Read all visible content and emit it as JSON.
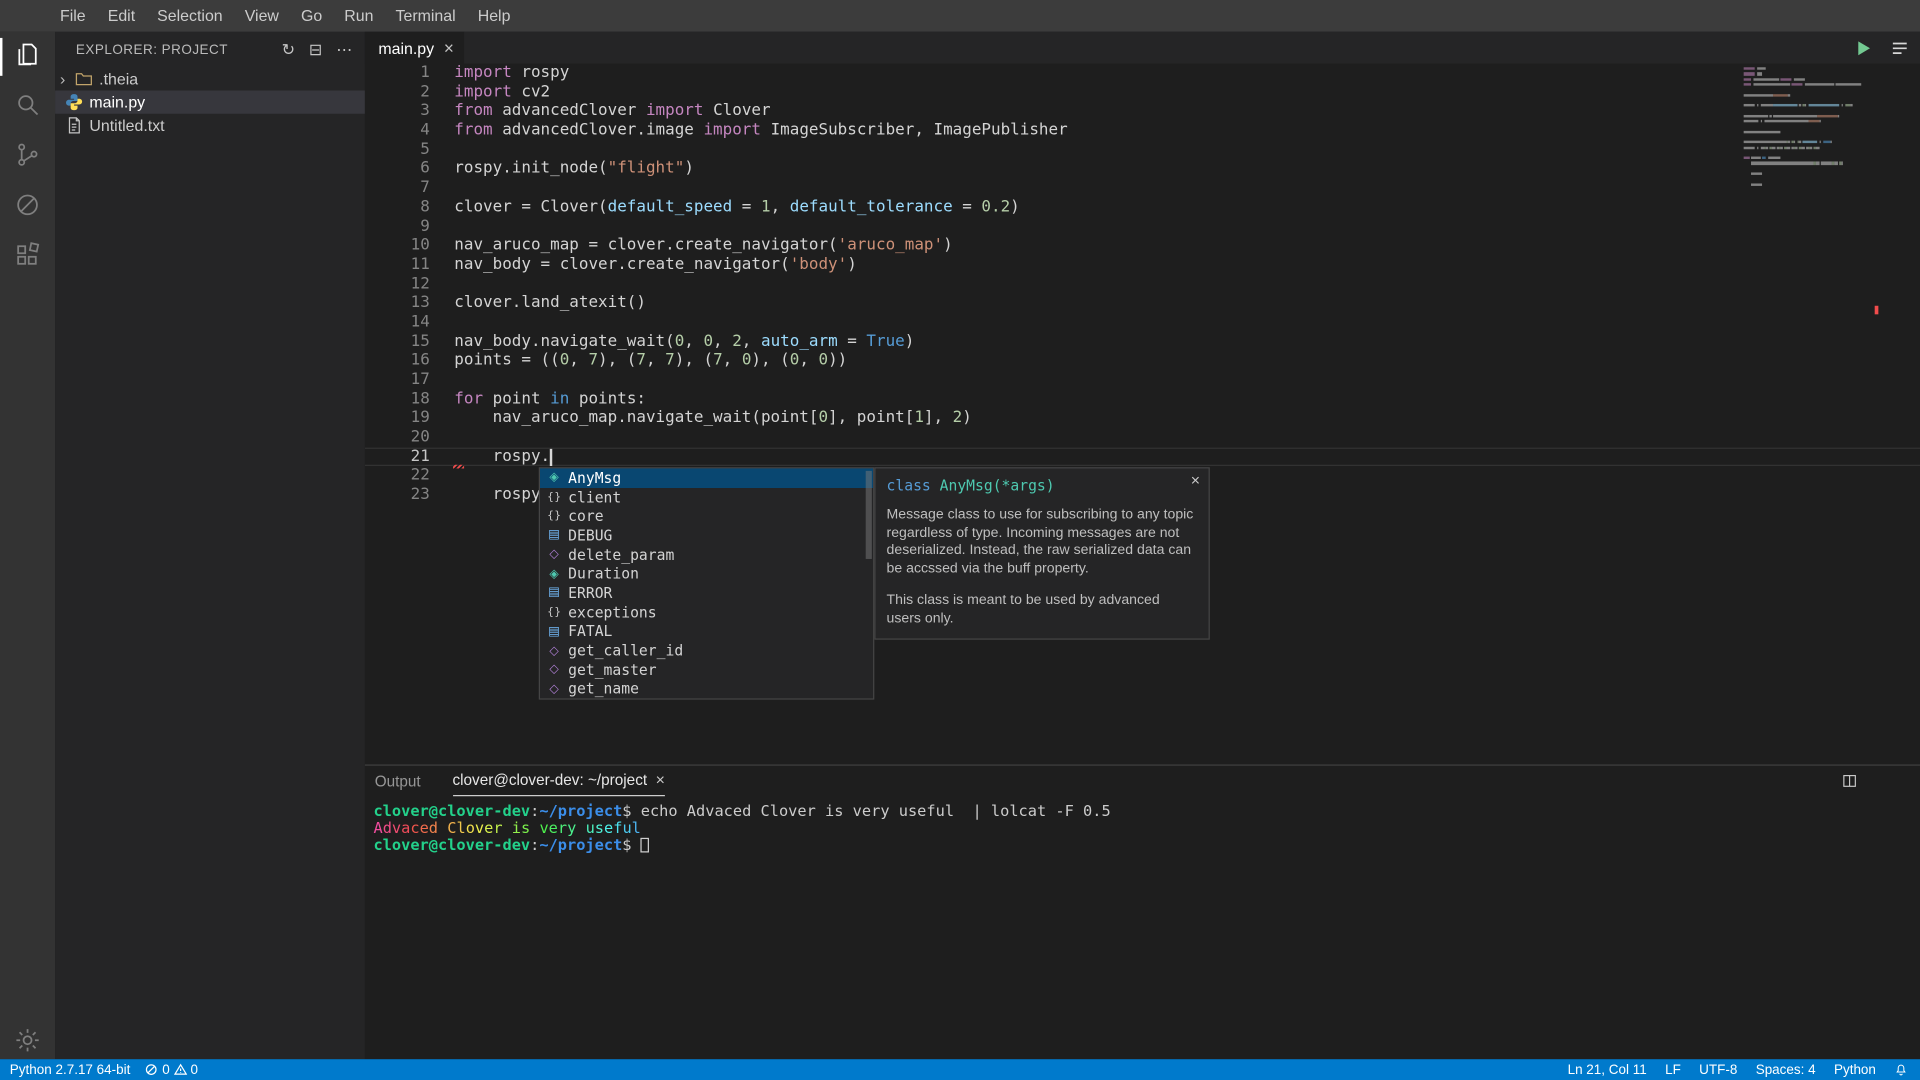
{
  "colors": {
    "accent": "#007acc",
    "selection": "#094771",
    "error": "#f14c4c"
  },
  "menu_bar": {
    "items": [
      "File",
      "Edit",
      "Selection",
      "View",
      "Go",
      "Run",
      "Terminal",
      "Help"
    ]
  },
  "activity_bar": {
    "items": [
      {
        "id": "explorer",
        "icon": "files-icon",
        "active": true
      },
      {
        "id": "search",
        "icon": "search-icon",
        "active": false
      },
      {
        "id": "source-control",
        "icon": "source-control-icon",
        "active": false
      },
      {
        "id": "debug",
        "icon": "debug-icon",
        "active": false
      },
      {
        "id": "extensions",
        "icon": "extensions-icon",
        "active": false
      }
    ],
    "bottom_items": [
      {
        "id": "settings",
        "icon": "gear-icon"
      }
    ]
  },
  "explorer": {
    "title": "EXPLORER: PROJECT",
    "toolbar": [
      {
        "id": "refresh",
        "icon": "refresh-icon"
      },
      {
        "id": "collapse-all",
        "icon": "collapse-all-icon"
      },
      {
        "id": "more-actions",
        "icon": "ellipsis-icon"
      }
    ],
    "tree": [
      {
        "label": ".theia",
        "kind": "folder",
        "collapsed": true,
        "selected": false
      },
      {
        "label": "main.py",
        "kind": "python-file",
        "selected": true
      },
      {
        "label": "Untitled.txt",
        "kind": "text-file",
        "selected": false
      }
    ]
  },
  "editor": {
    "tabs": [
      {
        "label": "main.py",
        "active": true
      }
    ],
    "actions": [
      {
        "id": "run",
        "icon": "run-icon"
      },
      {
        "id": "open-editors",
        "icon": "layout-icon"
      }
    ],
    "cursor": {
      "line": 21,
      "col": 11
    },
    "lines": [
      {
        "n": 1,
        "t": [
          [
            "k",
            "import"
          ],
          [
            "p",
            " rospy"
          ]
        ]
      },
      {
        "n": 2,
        "t": [
          [
            "k",
            "import"
          ],
          [
            "p",
            " cv2"
          ]
        ]
      },
      {
        "n": 3,
        "t": [
          [
            "k",
            "from"
          ],
          [
            "p",
            " advancedClover "
          ],
          [
            "k",
            "import"
          ],
          [
            "p",
            " Clover"
          ]
        ]
      },
      {
        "n": 4,
        "t": [
          [
            "k",
            "from"
          ],
          [
            "p",
            " advancedClover.image "
          ],
          [
            "k",
            "import"
          ],
          [
            "p",
            " ImageSubscriber, ImagePublisher"
          ]
        ]
      },
      {
        "n": 5,
        "t": []
      },
      {
        "n": 6,
        "t": [
          [
            "p",
            "rospy.init_node("
          ],
          [
            "s",
            "\"flight\""
          ],
          [
            "p",
            ")"
          ]
        ]
      },
      {
        "n": 7,
        "t": []
      },
      {
        "n": 8,
        "t": [
          [
            "p",
            "clover = Clover("
          ],
          [
            "v",
            "default_speed"
          ],
          [
            "p",
            " = "
          ],
          [
            "n",
            "1"
          ],
          [
            "p",
            ", "
          ],
          [
            "v",
            "default_tolerance"
          ],
          [
            "p",
            " = "
          ],
          [
            "n",
            "0.2"
          ],
          [
            "p",
            ")"
          ]
        ]
      },
      {
        "n": 9,
        "t": []
      },
      {
        "n": 10,
        "t": [
          [
            "p",
            "nav_aruco_map = clover.create_navigator("
          ],
          [
            "s",
            "'aruco_map'"
          ],
          [
            "p",
            ")"
          ]
        ]
      },
      {
        "n": 11,
        "t": [
          [
            "p",
            "nav_body = clover.create_navigator("
          ],
          [
            "s",
            "'body'"
          ],
          [
            "p",
            ")"
          ]
        ]
      },
      {
        "n": 12,
        "t": []
      },
      {
        "n": 13,
        "t": [
          [
            "p",
            "clover.land_atexit()"
          ]
        ]
      },
      {
        "n": 14,
        "t": []
      },
      {
        "n": 15,
        "t": [
          [
            "p",
            "nav_body.navigate_wait("
          ],
          [
            "n",
            "0"
          ],
          [
            "p",
            ", "
          ],
          [
            "n",
            "0"
          ],
          [
            "p",
            ", "
          ],
          [
            "n",
            "2"
          ],
          [
            "p",
            ", "
          ],
          [
            "v",
            "auto_arm"
          ],
          [
            "p",
            " = "
          ],
          [
            "b",
            "True"
          ],
          [
            "p",
            ")"
          ]
        ]
      },
      {
        "n": 16,
        "t": [
          [
            "p",
            "points = (("
          ],
          [
            "n",
            "0"
          ],
          [
            "p",
            ", "
          ],
          [
            "n",
            "7"
          ],
          [
            "p",
            "), ("
          ],
          [
            "n",
            "7"
          ],
          [
            "p",
            ", "
          ],
          [
            "n",
            "7"
          ],
          [
            "p",
            "), ("
          ],
          [
            "n",
            "7"
          ],
          [
            "p",
            ", "
          ],
          [
            "n",
            "0"
          ],
          [
            "p",
            "), ("
          ],
          [
            "n",
            "0"
          ],
          [
            "p",
            ", "
          ],
          [
            "n",
            "0"
          ],
          [
            "p",
            "))"
          ]
        ]
      },
      {
        "n": 17,
        "t": []
      },
      {
        "n": 18,
        "t": [
          [
            "k",
            "for"
          ],
          [
            "p",
            " point "
          ],
          [
            "b",
            "in"
          ],
          [
            "p",
            " points:"
          ]
        ]
      },
      {
        "n": 19,
        "t": [
          [
            "p",
            "    nav_aruco_map.navigate_wait(point["
          ],
          [
            "n",
            "0"
          ],
          [
            "p",
            "], point["
          ],
          [
            "n",
            "1"
          ],
          [
            "p",
            "], "
          ],
          [
            "n",
            "2"
          ],
          [
            "p",
            ")"
          ]
        ]
      },
      {
        "n": 20,
        "t": []
      },
      {
        "n": 21,
        "t": [
          [
            "p",
            "    rospy."
          ]
        ]
      },
      {
        "n": 22,
        "t": []
      },
      {
        "n": 23,
        "t": [
          [
            "p",
            "    rospy."
          ]
        ]
      }
    ]
  },
  "suggest_widget": {
    "items": [
      {
        "label": "AnyMsg",
        "kind": "class",
        "selected": true
      },
      {
        "label": "client",
        "kind": "module",
        "selected": false
      },
      {
        "label": "core",
        "kind": "module",
        "selected": false
      },
      {
        "label": "DEBUG",
        "kind": "constant",
        "selected": false
      },
      {
        "label": "delete_param",
        "kind": "function",
        "selected": false
      },
      {
        "label": "Duration",
        "kind": "class",
        "selected": false
      },
      {
        "label": "ERROR",
        "kind": "constant",
        "selected": false
      },
      {
        "label": "exceptions",
        "kind": "module",
        "selected": false
      },
      {
        "label": "FATAL",
        "kind": "constant",
        "selected": false
      },
      {
        "label": "get_caller_id",
        "kind": "function",
        "selected": false
      },
      {
        "label": "get_master",
        "kind": "function",
        "selected": false
      },
      {
        "label": "get_name",
        "kind": "function",
        "selected": false
      }
    ],
    "docs": {
      "keyword": "class ",
      "name": "AnyMsg(*args)",
      "close": "×",
      "paragraphs": [
        "Message class to use for subscribing to any topic regardless of type. Incoming messages are not deserialized. Instead, the raw serialized data can be accssed via the buff property.",
        "This class is meant to be used by advanced users only."
      ]
    }
  },
  "panel": {
    "tabs": [
      {
        "label": "Output",
        "active": false,
        "closable": false
      },
      {
        "label": "clover@clover-dev: ~/project",
        "active": true,
        "closable": true
      }
    ],
    "actions": [
      {
        "id": "maximize",
        "icon": "maximize-panel-icon"
      }
    ],
    "terminal": {
      "lines": [
        {
          "type": "prompt-command",
          "user": "clover@clover-dev",
          "path": "~/project",
          "command": " echo Advaced Clover is very useful  | lolcat -F 0.5"
        },
        {
          "type": "rainbow",
          "text": "Advaced Clover is very useful"
        },
        {
          "type": "prompt-cursor",
          "user": "clover@clover-dev",
          "path": "~/project",
          "command": " "
        }
      ]
    }
  },
  "status_bar": {
    "left": [
      {
        "id": "python-version",
        "label": "Python 2.7.17 64-bit"
      }
    ],
    "problems": {
      "errors": "0",
      "warnings": "0"
    },
    "right": [
      {
        "id": "cursor-position",
        "label": "Ln 21, Col 11"
      },
      {
        "id": "eol",
        "label": "LF"
      },
      {
        "id": "encoding",
        "label": "UTF-8"
      },
      {
        "id": "indentation",
        "label": "Spaces: 4"
      },
      {
        "id": "language",
        "label": "Python"
      },
      {
        "id": "notifications",
        "icon": "bell-icon",
        "label": ""
      }
    ]
  }
}
